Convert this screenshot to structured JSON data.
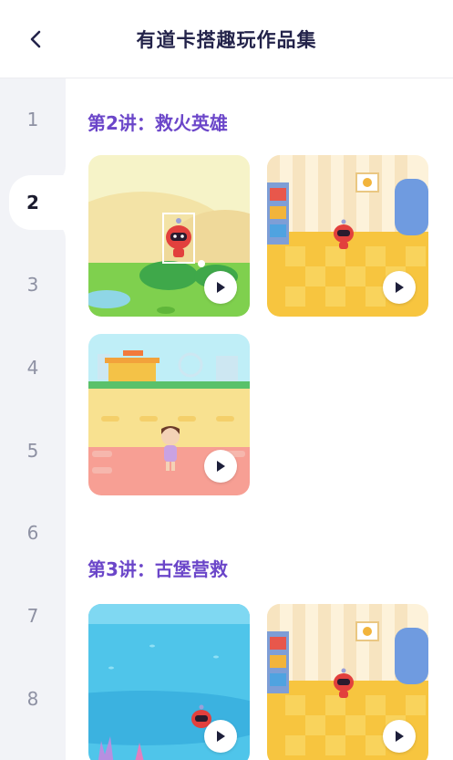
{
  "header": {
    "title": "有道卡搭趣玩作品集"
  },
  "sidebar": {
    "items": [
      "1",
      "2",
      "3",
      "4",
      "5",
      "6",
      "7",
      "8"
    ],
    "active": "2"
  },
  "sections": [
    {
      "title": "第2讲：救火英雄"
    },
    {
      "title": "第3讲：古堡营救"
    }
  ],
  "colors": {
    "accent": "#6b46c9",
    "sidebar_bg": "#f2f3f7",
    "title": "#23234a"
  },
  "icons": {
    "back": "chevron-left-icon",
    "play": "play-icon"
  }
}
